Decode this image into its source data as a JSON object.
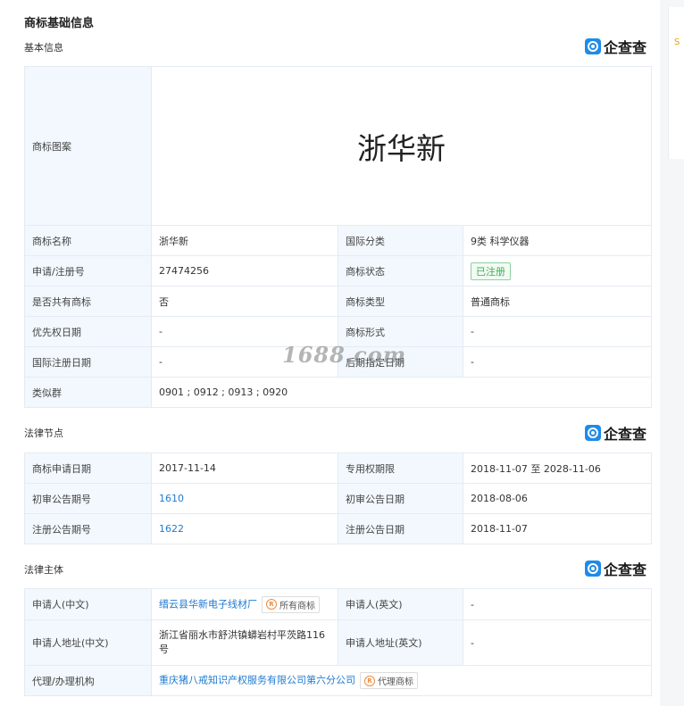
{
  "page_title": "商标基础信息",
  "brand": {
    "logo_text": "企查查",
    "icon": "qichacha-logo-icon",
    "color": "#1f8be8"
  },
  "sections": {
    "basic": {
      "title": "基本信息",
      "trademark_label": "商标图案",
      "trademark_image_text": "浙华新",
      "rows": [
        {
          "l1": "商标名称",
          "v1": "浙华新",
          "l2": "国际分类",
          "v2": "9类 科学仪器"
        },
        {
          "l1": "申请/注册号",
          "v1": "27474256",
          "l2": "商标状态",
          "v2": "已注册"
        },
        {
          "l1": "是否共有商标",
          "v1": "否",
          "l2": "商标类型",
          "v2": "普通商标"
        },
        {
          "l1": "优先权日期",
          "v1": "-",
          "l2": "商标形式",
          "v2": "-"
        },
        {
          "l1": "国际注册日期",
          "v1": "-",
          "l2": "后期指定日期",
          "v2": "-"
        }
      ],
      "similar_group_label": "类似群",
      "similar_group_value": "0901 ; 0912 ; 0913 ; 0920"
    },
    "legal_nodes": {
      "title": "法律节点",
      "rows": [
        {
          "l1": "商标申请日期",
          "v1": "2017-11-14",
          "l2": "专用权期限",
          "v2": "2018-11-07 至 2028-11-06"
        },
        {
          "l1": "初审公告期号",
          "v1": "1610",
          "l2": "初审公告日期",
          "v2": "2018-08-06"
        },
        {
          "l1": "注册公告期号",
          "v1": "1622",
          "l2": "注册公告日期",
          "v2": "2018-11-07"
        }
      ]
    },
    "legal_subject": {
      "title": "法律主体",
      "applicant_cn_label": "申请人(中文)",
      "applicant_cn_value": "缙云县华新电子线材厂",
      "applicant_tag": "所有商标",
      "applicant_en_label": "申请人(英文)",
      "applicant_en_value": "-",
      "address_cn_label": "申请人地址(中文)",
      "address_cn_value": "浙江省丽水市舒洪镇蟒岩村平茨路116号",
      "address_en_label": "申请人地址(英文)",
      "address_en_value": "-",
      "agent_label": "代理/办理机构",
      "agent_value": "重庆猪八戒知识产权服务有限公司第六分公司",
      "agent_tag": "代理商标"
    }
  },
  "watermark": "1688.com",
  "side_panel_char": "S",
  "colors": {
    "label_bg": "#f2f8fd",
    "link": "#1f7bd0",
    "status_green": "#3fae53"
  }
}
